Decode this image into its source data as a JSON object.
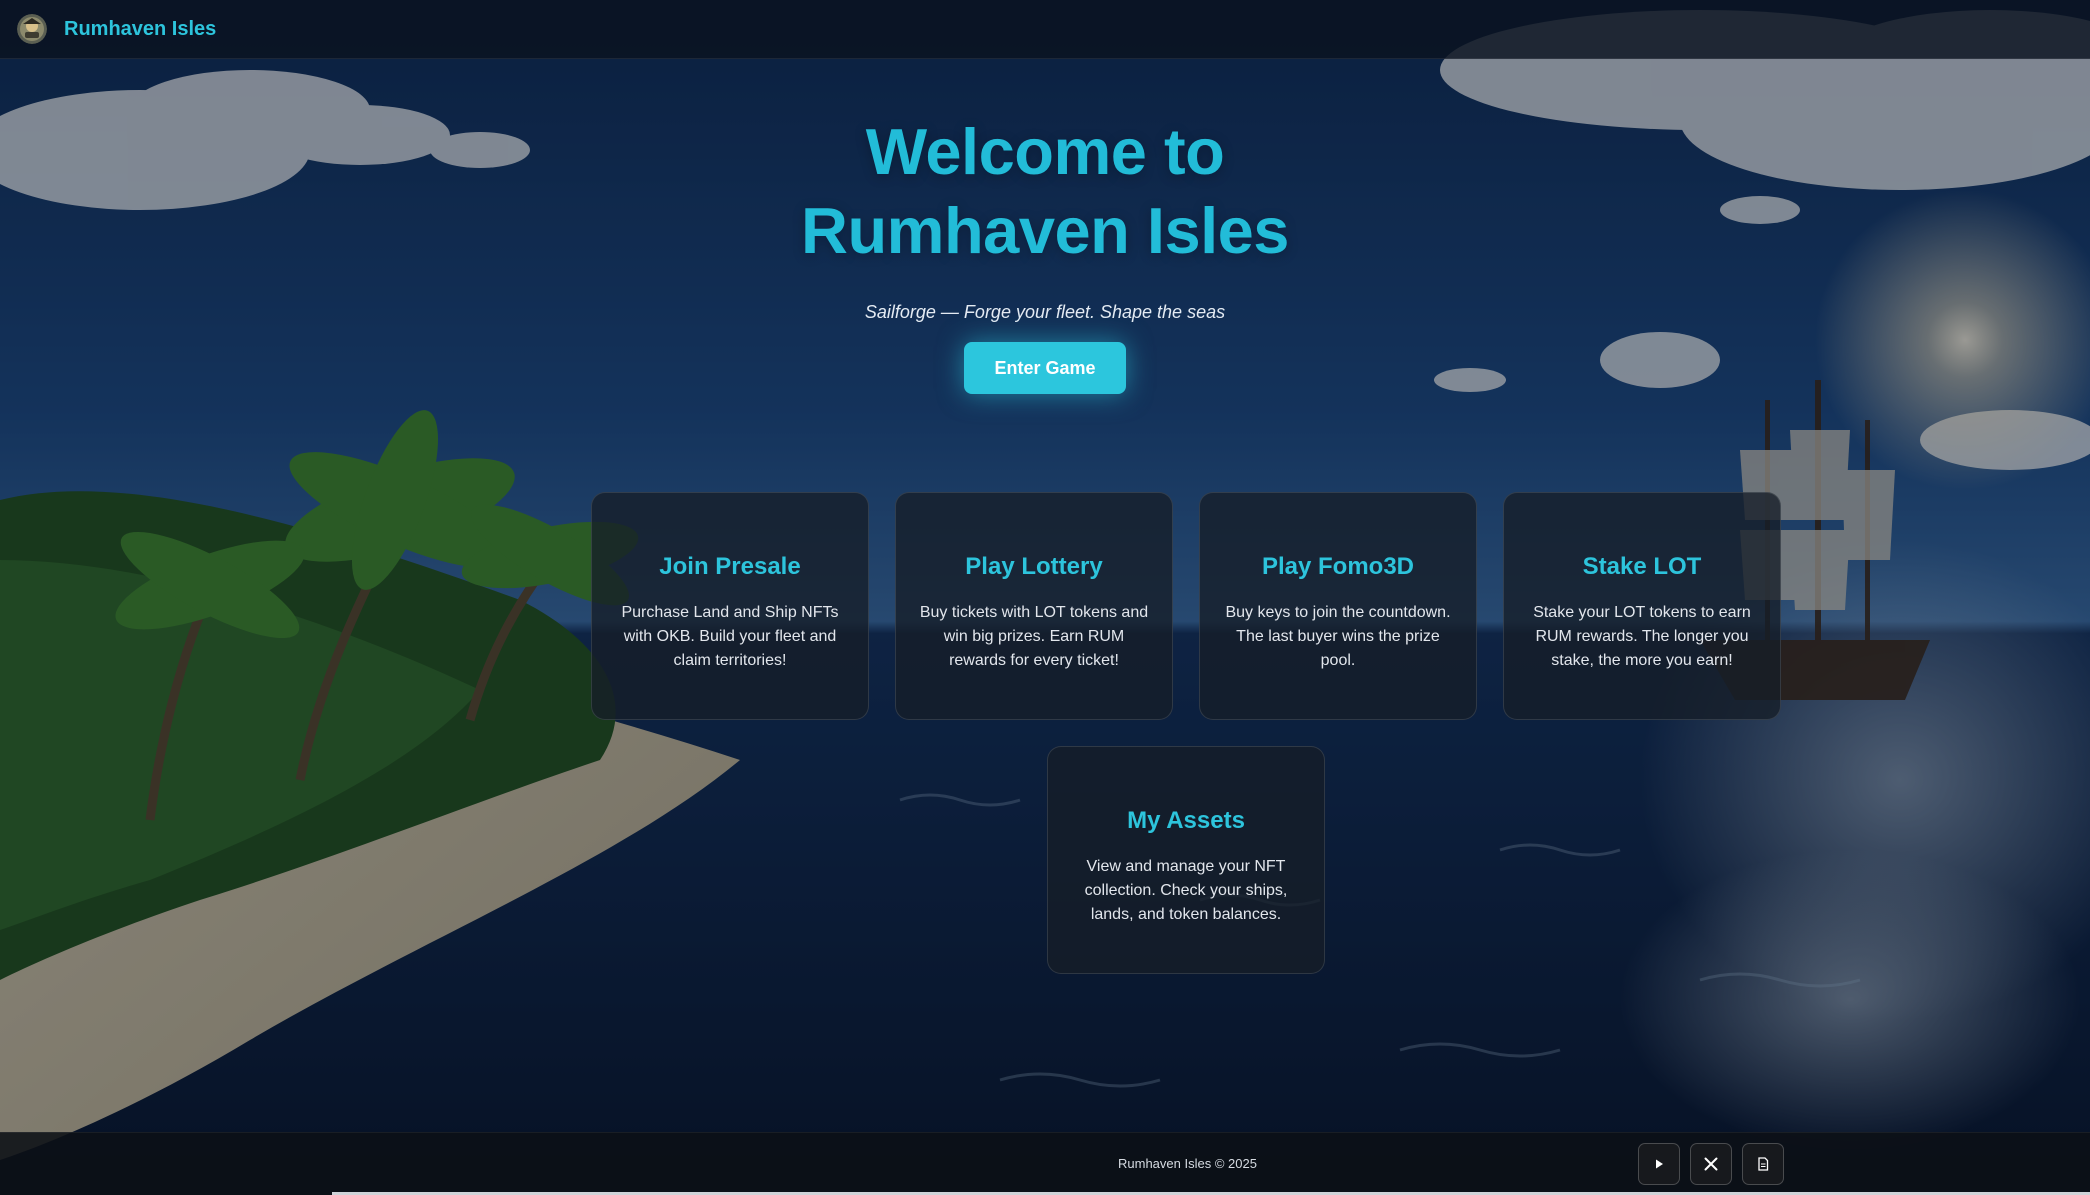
{
  "header": {
    "brand": "Rumhaven Isles",
    "logo_icon": "pirate-emblem-icon"
  },
  "hero": {
    "title_line1": "Welcome to",
    "title_line2": "Rumhaven Isles",
    "subtitle": "Sailforge — Forge your fleet. Shape the seas",
    "enter_button": "Enter Game"
  },
  "cards": [
    {
      "title": "Join Presale",
      "description": "Purchase Land and Ship NFTs with OKB. Build your fleet and claim territories!"
    },
    {
      "title": "Play Lottery",
      "description": "Buy tickets with LOT tokens and win big prizes. Earn RUM rewards for every ticket!"
    },
    {
      "title": "Play Fomo3D",
      "description": "Buy keys to join the countdown. The last buyer wins the prize pool."
    },
    {
      "title": "Stake LOT",
      "description": "Stake your LOT tokens to earn RUM rewards. The longer you stake, the more you earn!"
    },
    {
      "title": "My Assets",
      "description": "View and manage your NFT collection. Check your ships, lands, and token balances."
    }
  ],
  "footer": {
    "copyright": "Rumhaven Isles © 2025",
    "social": [
      {
        "icon": "play-icon"
      },
      {
        "icon": "x-logo-icon"
      },
      {
        "icon": "document-icon"
      }
    ]
  },
  "colors": {
    "accent": "#2dc4dc",
    "button": "#2cc6dd",
    "card_bg": "#161e28",
    "header_bg": "#0a1220"
  }
}
